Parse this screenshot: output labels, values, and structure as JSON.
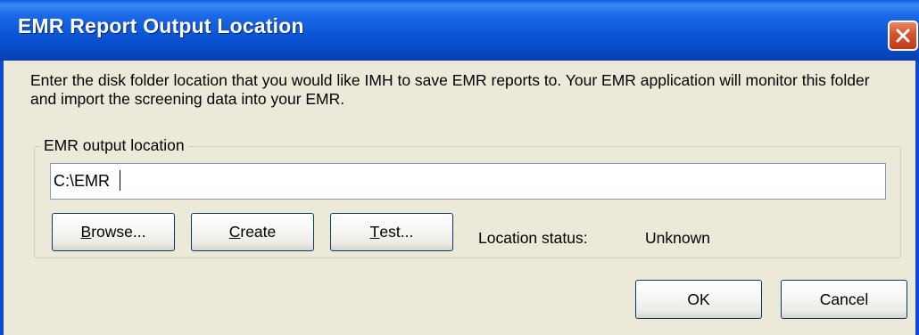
{
  "window": {
    "title": "EMR Report Output Location",
    "close_icon": "close-icon"
  },
  "description": "Enter the disk folder location that you would like IMH to save EMR reports to. Your EMR application will monitor this folder and import the screening data into your EMR.",
  "group": {
    "label": "EMR output location",
    "path_value": "C:\\EMR",
    "buttons": {
      "browse": {
        "accel": "B",
        "rest": "rowse..."
      },
      "create": {
        "accel": "C",
        "rest": "reate"
      },
      "test": {
        "accel": "T",
        "rest": "est..."
      }
    },
    "status_label": "Location status:",
    "status_value": "Unknown"
  },
  "footer": {
    "ok_label": "OK",
    "cancel_label": "Cancel"
  },
  "colors": {
    "titlebar": "#0a56d8",
    "dialog_bg": "#ece9d8",
    "close_button": "#d6512c",
    "button_border": "#003c74"
  }
}
